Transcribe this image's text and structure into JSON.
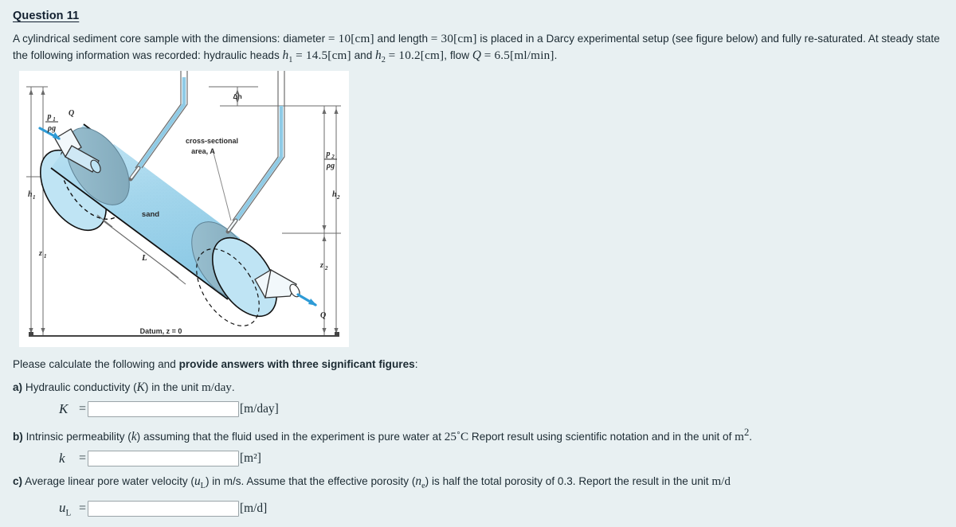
{
  "question": {
    "title": "Question 11",
    "statement_parts": {
      "p1": "A cylindrical sediment core sample with the dimensions: diameter ",
      "eq_diam": "= 10[cm]",
      "p2": " and length ",
      "eq_len": "= 30[cm]",
      "p3": " is placed in a Darcy experimental setup (see figure below) and fully re-saturated. At steady state the following information was recorded: hydraulic heads ",
      "h1_sym": "h",
      "h1_sub": "1",
      "eq_h1": "= 14.5[cm]",
      "p4": " and ",
      "h2_sym": "h",
      "h2_sub": "2",
      "eq_h2": "= 10.2[cm]",
      "p5": ", flow ",
      "q_sym": "Q",
      "eq_q": "= 6.5[ml/min]",
      "p6": "."
    }
  },
  "figure": {
    "labels": {
      "p1_rho_g_num": "p",
      "p1_rho_g_sub": "1",
      "p1_rho_g_den": "ρg",
      "p2_rho_g_num": "p",
      "p2_rho_g_sub": "2",
      "p2_rho_g_den": "ρg",
      "q_inlet": "Q",
      "q_outlet": "Q",
      "delta_h": "Δh",
      "h1": "h",
      "h1_sub": "1",
      "h2": "h",
      "h2_sub": "2",
      "z1": "z",
      "z1_sub": "1",
      "z2": "z",
      "z2_sub": "2",
      "length_L": "L",
      "sand": "sand",
      "cross_section_line1": "cross-sectional",
      "cross_section_line2": "area, A",
      "datum": "Datum, z = 0"
    },
    "colors": {
      "sand_fill": "#a9d9ee",
      "end_cap_fill": "#8fb4c4",
      "water_blue": "#2e9bd6",
      "outline": "#111111",
      "dimension_gray": "#6b6b6b",
      "panel_bg": "#ffffff"
    }
  },
  "instructions": {
    "prefix": "Please calculate the following and ",
    "bold": "provide answers with three significant figures",
    "suffix": ":"
  },
  "parts": [
    {
      "id": "a",
      "label": "a)",
      "text_before": " Hydraulic conductivity (",
      "symbol": "K",
      "text_after": ") in the unit ",
      "unit_inline": "m/day",
      "text_end": ".",
      "answer_symbol": "K",
      "answer_symbol_sub": "",
      "answer_value": "",
      "answer_placeholder": "",
      "answer_unit": "[m/day]"
    },
    {
      "id": "b",
      "label": "b)",
      "text_before": " Intrinsic permeability (",
      "symbol": "k",
      "text_after": ") assuming that the fluid used in the experiment is pure water at ",
      "temperature": "25",
      "degree": "˚",
      "temp_unit": "C",
      "text_mid": " Report result using scientific notation and in the unit of ",
      "unit_inline": "m",
      "unit_sup": "2",
      "text_end": ".",
      "answer_symbol": "k",
      "answer_symbol_sub": "",
      "answer_value": "",
      "answer_placeholder": "",
      "answer_unit": "[m²]"
    },
    {
      "id": "c",
      "label": "c)",
      "text_before": " Average linear pore water velocity (",
      "symbol": "u",
      "symbol_sub": "L",
      "text_after": ") in m/s. Assume that the effective porosity (",
      "symbol2": "n",
      "symbol2_sub": "e",
      "text_mid": ") is half the total porosity of 0.3. Report the result in the unit ",
      "unit_inline": "m/d",
      "text_end": "",
      "answer_symbol": "u",
      "answer_symbol_sub": "L",
      "answer_value": "",
      "answer_placeholder": "",
      "answer_unit": "[m/d]"
    }
  ],
  "theme": {
    "page_bg": "#e8f0f2",
    "text_color": "#1c2b33",
    "input_bg": "#ffffff",
    "input_border": "#9aa4a8"
  }
}
